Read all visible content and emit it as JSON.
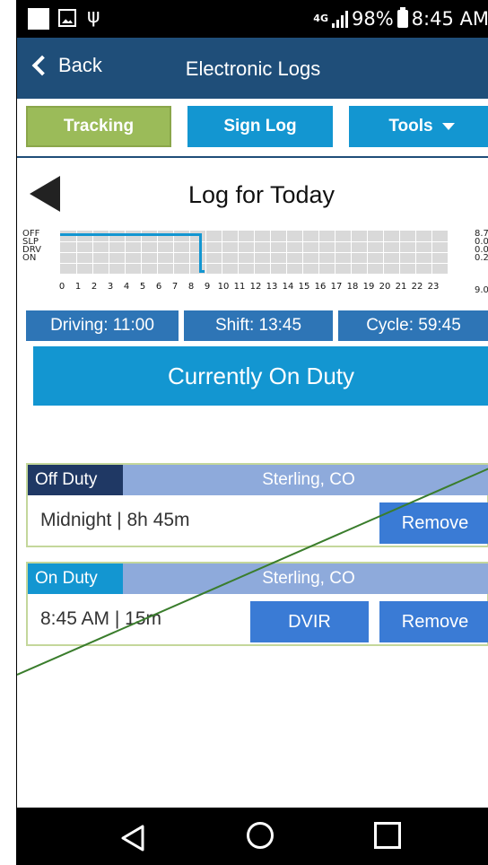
{
  "status_bar": {
    "network": "4G",
    "battery": "98%",
    "time": "8:45 AM",
    "icons": [
      "notification-square-icon",
      "image-icon",
      "usb-icon",
      "signal-icon",
      "battery-icon"
    ]
  },
  "header": {
    "back_label": "Back",
    "title": "Electronic Logs",
    "color": "#1f4e79"
  },
  "toolbar": {
    "tracking_label": "Tracking",
    "sign_log_label": "Sign Log",
    "tools_label": "Tools",
    "tracking_color": "#9bbb59",
    "button_color": "#1396d1"
  },
  "log": {
    "title": "Log for Today",
    "status_labels": [
      "OFF",
      "SLP",
      "DRV",
      "ON"
    ],
    "hour_labels": [
      "0",
      "1",
      "2",
      "3",
      "4",
      "5",
      "6",
      "7",
      "8",
      "9",
      "10",
      "11",
      "12",
      "13",
      "14",
      "15",
      "16",
      "17",
      "18",
      "19",
      "20",
      "21",
      "22",
      "23"
    ],
    "totals": [
      "8.7",
      "0.0",
      "0.0",
      "0.2"
    ],
    "total_sum": "9.0"
  },
  "counters": {
    "driving": "Driving: 11:00",
    "shift": "Shift: 13:45",
    "cycle": "Cycle: 59:45"
  },
  "duty_status": "Currently On Duty",
  "entries": [
    {
      "status": "Off Duty",
      "location": "Sterling, CO",
      "time": "Midnight | 8h 45m",
      "remove_label": "Remove"
    },
    {
      "status": "On Duty",
      "location": "Sterling, CO",
      "time": "8:45 AM | 15m",
      "dvir_label": "DVIR",
      "remove_label": "Remove"
    }
  ],
  "navbar": {
    "icons": [
      "nav-back-icon",
      "nav-home-icon",
      "nav-recent-apps-icon"
    ]
  }
}
